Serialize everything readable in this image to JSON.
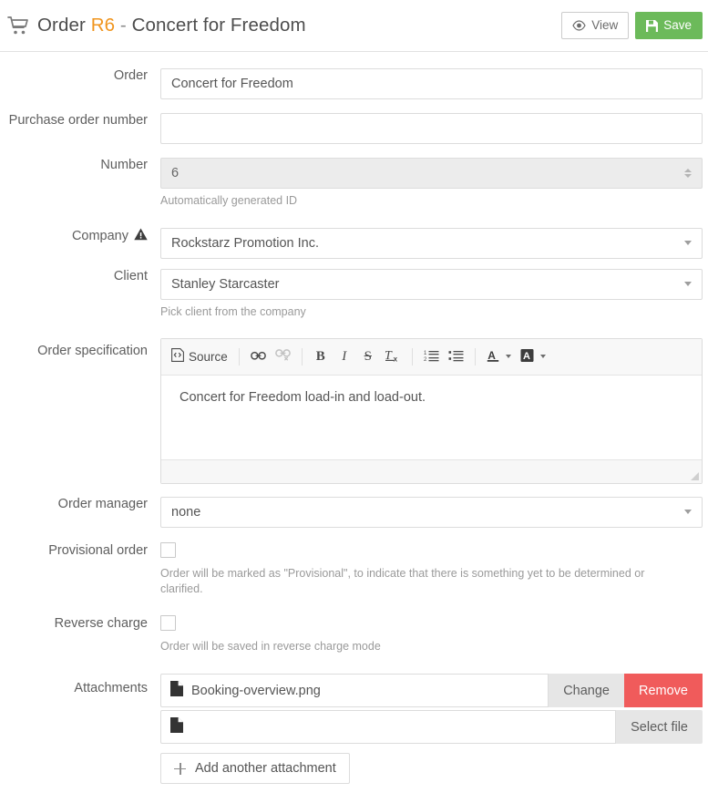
{
  "header": {
    "icon": "shopping-cart-icon",
    "title_prefix": "Order ",
    "order_code": "R6",
    "title_separator": " - ",
    "title_name": "Concert for Freedom",
    "view_label": "View",
    "save_label": "Save",
    "view_icon": "eye-icon",
    "save_icon": "floppy-disk-icon",
    "save_color": "#6cba5a",
    "order_code_color": "#f0951e"
  },
  "fields": {
    "order": {
      "label": "Order",
      "value": "Concert for Freedom",
      "placeholder": ""
    },
    "purchase_order_number": {
      "label": "Purchase order number",
      "value": "",
      "placeholder": ""
    },
    "number": {
      "label": "Number",
      "value": "6",
      "help": "Automatically generated ID",
      "disabled": true
    },
    "company": {
      "label": "Company",
      "warning_icon": "warning-triangle-icon",
      "value": "Rockstarz Promotion Inc."
    },
    "client": {
      "label": "Client",
      "value": "Stanley Starcaster",
      "help": "Pick client from the company"
    },
    "order_specification": {
      "label": "Order specification",
      "body_text": "Concert for Freedom load-in and load-out."
    },
    "order_manager": {
      "label": "Order manager",
      "value": "none"
    },
    "provisional_order": {
      "label": "Provisional order",
      "checked": false,
      "help": "Order will be marked as \"Provisional\", to indicate that there is something yet to be determined or clarified."
    },
    "reverse_charge": {
      "label": "Reverse charge",
      "checked": false,
      "help": "Order will be saved in reverse charge mode"
    },
    "attachments": {
      "label": "Attachments",
      "rows": [
        {
          "filename": "Booking-overview.png",
          "change_label": "Change",
          "remove_label": "Remove"
        },
        {
          "filename": "",
          "select_label": "Select file"
        }
      ],
      "add_label": "Add another attachment",
      "remove_color": "#f05b5b"
    }
  },
  "editor_toolbar": {
    "source_label": "Source",
    "buttons": [
      {
        "name": "source",
        "label": "Source"
      },
      {
        "name": "link",
        "label": ""
      },
      {
        "name": "unlink",
        "label": ""
      },
      {
        "name": "bold",
        "label": "B"
      },
      {
        "name": "italic",
        "label": "I"
      },
      {
        "name": "strike",
        "label": "S"
      },
      {
        "name": "remove-format",
        "label": "Tx"
      },
      {
        "name": "numbered-list",
        "label": ""
      },
      {
        "name": "bulleted-list",
        "label": ""
      },
      {
        "name": "text-color",
        "label": "A"
      },
      {
        "name": "background-color",
        "label": "A"
      }
    ]
  }
}
